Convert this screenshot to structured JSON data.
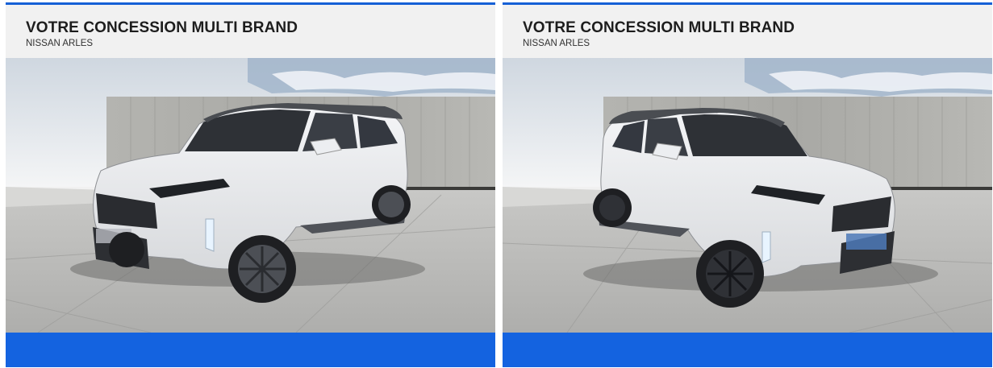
{
  "listing": {
    "cards": [
      {
        "title": "VOTRE CONCESSION MULTI BRAND",
        "subtitle": "NISSAN ARLES",
        "photo_icon": "car-front-left-photo"
      },
      {
        "title": "VOTRE CONCESSION MULTI BRAND",
        "subtitle": "NISSAN ARLES",
        "photo_icon": "car-front-right-photo"
      }
    ]
  },
  "colors": {
    "accent_blue": "#1463e0",
    "header_bg": "#f1f1f1",
    "car_body": "#e9eaec",
    "floor": "#bfbfbd"
  }
}
